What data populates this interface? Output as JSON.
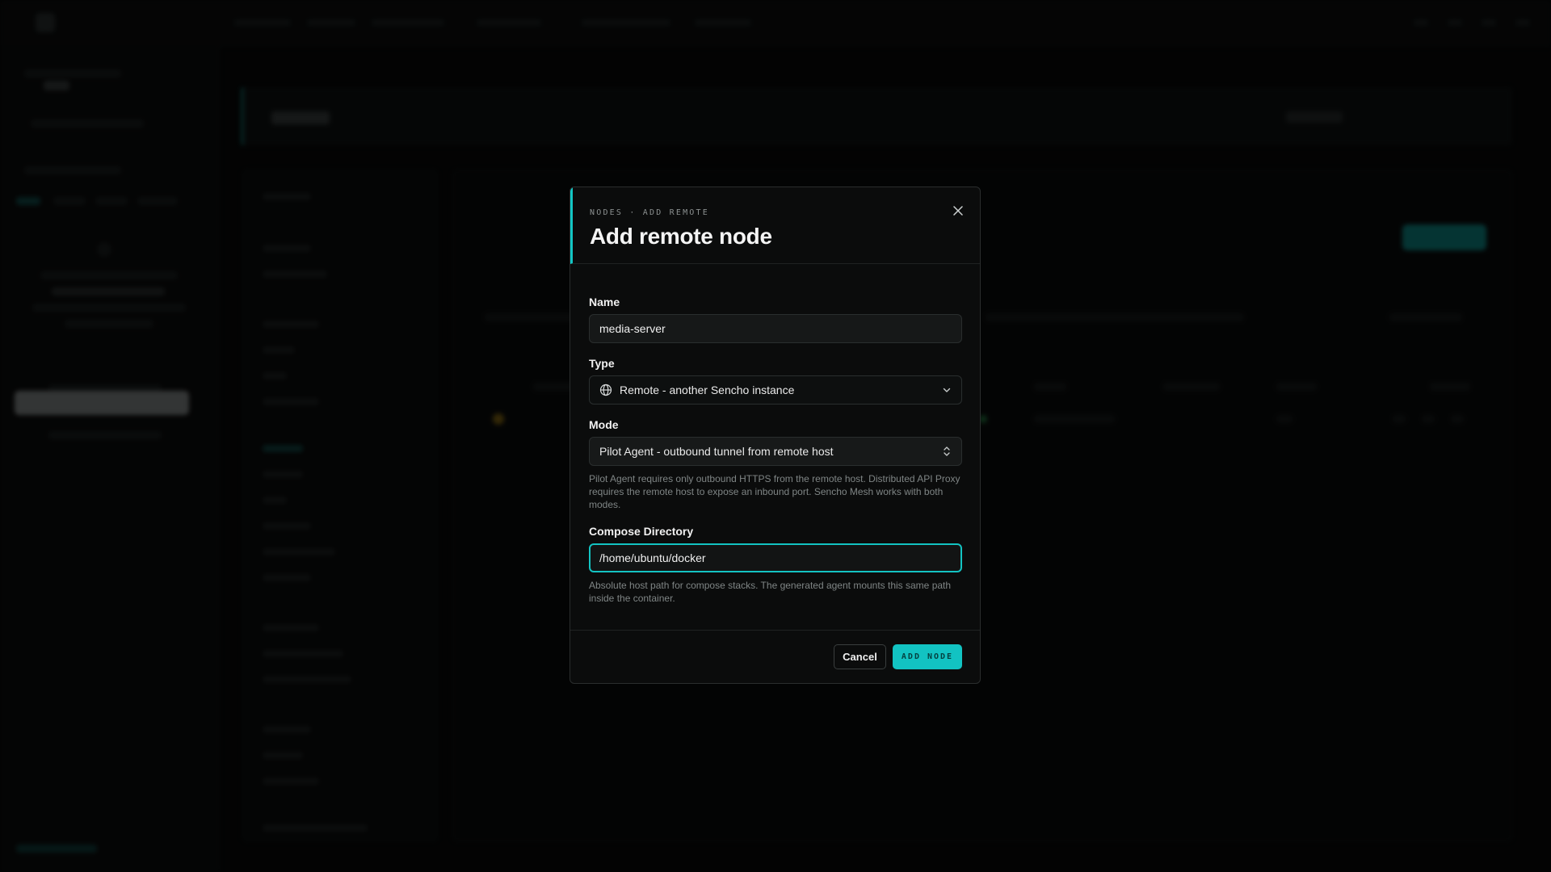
{
  "modal": {
    "eyebrow": "NODES · ADD REMOTE",
    "title": "Add remote node",
    "close_icon": "close-icon",
    "fields": {
      "name": {
        "label": "Name",
        "value": "media-server"
      },
      "type": {
        "label": "Type",
        "icon": "globe-icon",
        "value": "Remote - another Sencho instance"
      },
      "mode": {
        "label": "Mode",
        "value": "Pilot Agent - outbound tunnel from remote host",
        "help": "Pilot Agent requires only outbound HTTPS from the remote host. Distributed API Proxy requires the remote host to expose an inbound port. Sencho Mesh works with both modes."
      },
      "compose_directory": {
        "label": "Compose Directory",
        "value": "/home/ubuntu/docker",
        "help": "Absolute host path for compose stacks. The generated agent mounts this same path inside the container."
      }
    },
    "footer": {
      "cancel_label": "Cancel",
      "add_label": "ADD NODE"
    }
  },
  "colors": {
    "accent": "#12c3c2",
    "modal_bg": "#0b0c0c",
    "page_bg": "#050606"
  }
}
